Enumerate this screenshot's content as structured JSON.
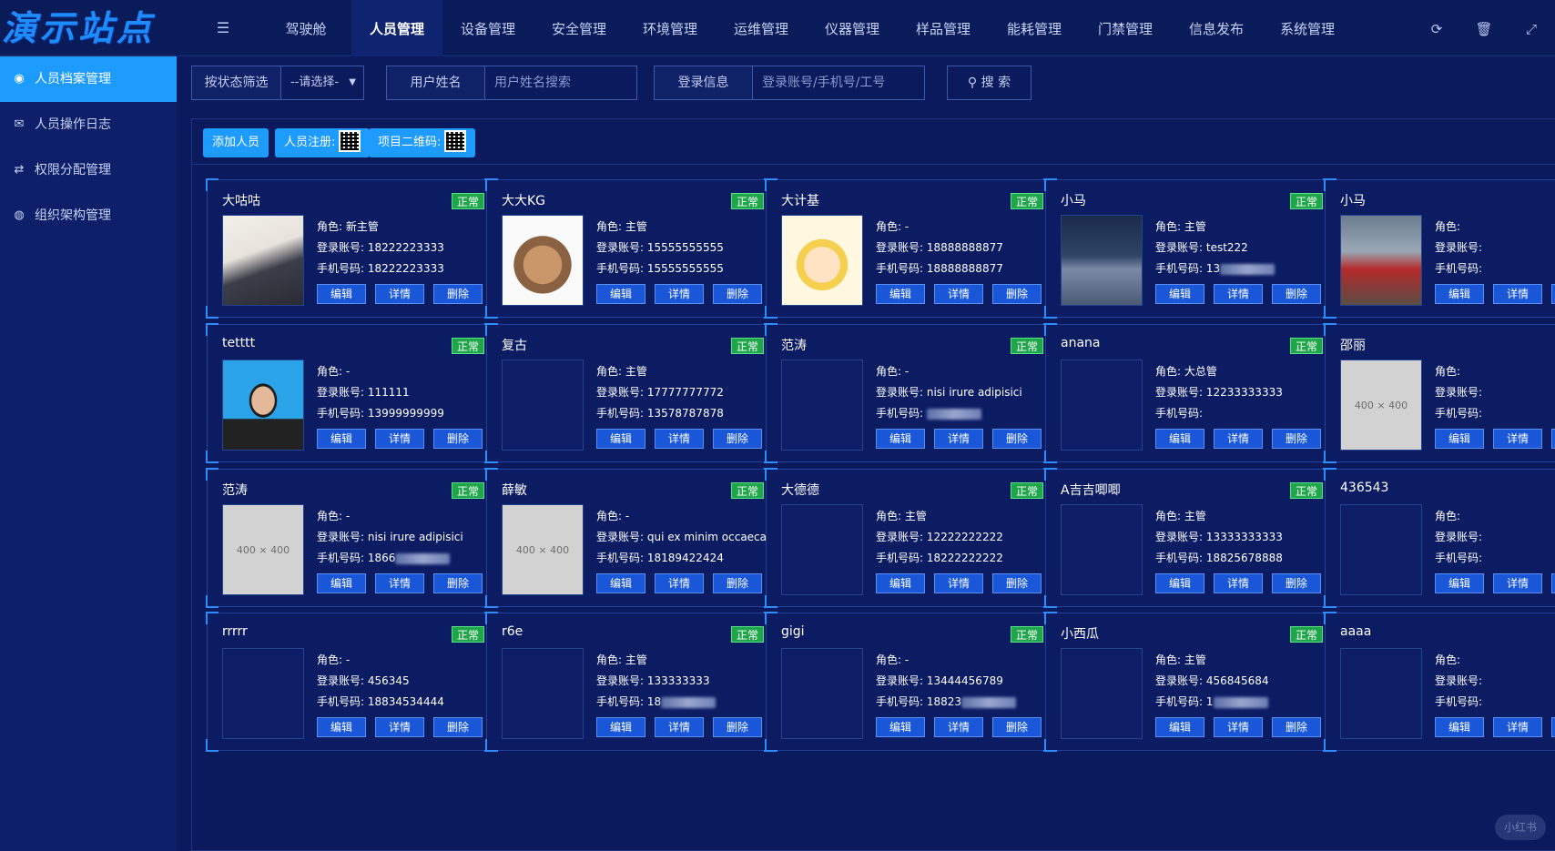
{
  "app": {
    "logo_text": "演示站点"
  },
  "nav": {
    "items": [
      "驾驶舱",
      "人员管理",
      "设备管理",
      "安全管理",
      "环境管理",
      "运维管理",
      "仪器管理",
      "样品管理",
      "能耗管理",
      "门禁管理",
      "信息发布",
      "系统管理"
    ],
    "active_index": 1
  },
  "top_icons": [
    "refresh-icon",
    "trash-icon",
    "fullscreen-icon"
  ],
  "sidebar": {
    "items": [
      {
        "label": "人员档案管理",
        "icon": "user-circle-icon",
        "active": true
      },
      {
        "label": "人员操作日志",
        "icon": "envelope-icon",
        "active": false
      },
      {
        "label": "权限分配管理",
        "icon": "handshake-icon",
        "active": false
      },
      {
        "label": "组织架构管理",
        "icon": "globe-icon",
        "active": false
      }
    ]
  },
  "filters": {
    "status_label": "按状态筛选",
    "status_value": "--请选择-",
    "name_label": "用户姓名",
    "name_placeholder": "用户姓名搜索",
    "login_label": "登录信息",
    "login_placeholder": "登录账号/手机号/工号",
    "search_label": "搜 索"
  },
  "actions": {
    "add_label": "添加人员",
    "register_label": "人员注册:",
    "project_qr_label": "项目二维码:"
  },
  "card_labels": {
    "role": "角色: ",
    "account": "登录账号: ",
    "phone": "手机号码: ",
    "edit": "编辑",
    "detail": "详情",
    "delete": "删除"
  },
  "people": [
    {
      "name": "大咕咕",
      "status": "正常",
      "role": "新主管",
      "account": "18222223333",
      "phone": "18222223333",
      "photo": "art"
    },
    {
      "name": "大大KG",
      "status": "正常",
      "role": "主管",
      "account": "15555555555",
      "phone": "15555555555",
      "photo": "cat"
    },
    {
      "name": "大计基",
      "status": "正常",
      "role": "-",
      "account": "18888888877",
      "phone": "18888888877",
      "photo": "cartoon"
    },
    {
      "name": "小马",
      "status": "正常",
      "role": "主管",
      "account": "test222",
      "phone": "13",
      "phone_blur": true,
      "photo": "night"
    },
    {
      "name": "小马",
      "status": "",
      "role": "",
      "account": "",
      "phone": "",
      "photo": "room"
    },
    {
      "name": "tetttt",
      "status": "正常",
      "role": "-",
      "account": "111111",
      "phone": "13999999999",
      "photo": "portrait"
    },
    {
      "name": "复古",
      "status": "正常",
      "role": "主管",
      "account": "17777777772",
      "phone": "13578787878",
      "photo": ""
    },
    {
      "name": "范涛",
      "status": "正常",
      "role": "-",
      "account": "nisi irure adipisici",
      "phone": "",
      "phone_blur": true,
      "photo": ""
    },
    {
      "name": "anana",
      "status": "正常",
      "role": "大总管",
      "account": "12233333333",
      "phone": "",
      "photo": ""
    },
    {
      "name": "邵丽",
      "status": "",
      "role": "",
      "account": "",
      "phone": "",
      "photo": "grey"
    },
    {
      "name": "范涛",
      "status": "正常",
      "role": "-",
      "account": "nisi irure adipisici",
      "phone": "1866",
      "phone_blur": true,
      "photo": "grey"
    },
    {
      "name": "薛敏",
      "status": "正常",
      "role": "-",
      "account": "qui ex minim occaeca",
      "phone": "18189422424",
      "photo": "grey"
    },
    {
      "name": "大德德",
      "status": "正常",
      "role": "主管",
      "account": "12222222222",
      "phone": "18222222222",
      "photo": ""
    },
    {
      "name": "A吉吉唧唧",
      "status": "正常",
      "role": "主管",
      "account": "13333333333",
      "phone": "18825678888",
      "photo": ""
    },
    {
      "name": "436543",
      "status": "",
      "role": "",
      "account": "",
      "phone": "",
      "photo": ""
    },
    {
      "name": "rrrrr",
      "status": "正常",
      "role": "-",
      "account": "456345",
      "phone": "18834534444",
      "photo": ""
    },
    {
      "name": "r6e",
      "status": "正常",
      "role": "主管",
      "account": "133333333",
      "phone": "18",
      "phone_blur": true,
      "photo": ""
    },
    {
      "name": "gigi",
      "status": "正常",
      "role": "-",
      "account": "13444456789",
      "phone": "18823",
      "phone_blur": true,
      "photo": ""
    },
    {
      "name": "小西瓜",
      "status": "正常",
      "role": "主管",
      "account": "456845684",
      "phone": "1",
      "phone_blur": true,
      "photo": ""
    },
    {
      "name": "aaaa",
      "status": "",
      "role": "",
      "account": "",
      "phone": "",
      "photo": ""
    }
  ],
  "placeholder_photo_text": "400 × 400",
  "watermark": "小红书",
  "colors": {
    "background": "#0b1a5c",
    "accent": "#1e9bff",
    "status_ok": "#1fa64a",
    "button": "#1a57d8",
    "corner": "#2f8cff"
  }
}
